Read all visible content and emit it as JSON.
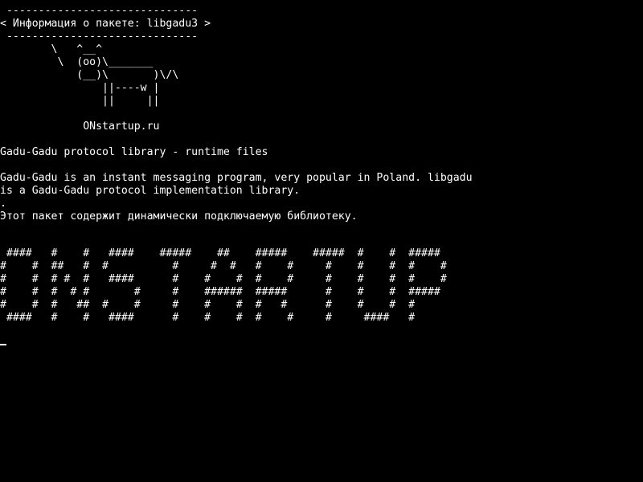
{
  "terminal": {
    "bg_color": "#000000",
    "fg_color": "#ffffff",
    "bubble": {
      "top_border": " ------------------------------",
      "text": "< Информация о пакете: libgadu3 >",
      "bottom_border": " ------------------------------"
    },
    "cow": [
      "        \\   ^__^",
      "         \\  (oo)\\_______",
      "            (__)\\       )\\/\\",
      "                ||----w |",
      "                ||     ||"
    ],
    "site": "             ONstartup.ru",
    "description": {
      "summary": "Gadu-Gadu protocol library - runtime files",
      "body_lines": [
        "Gadu-Gadu is an instant messaging program, very popular in Poland. libgadu",
        "is a Gadu-Gadu protocol implementation library.",
        ".",
        "Этот пакет содержит динамически подключаемую библиотеку."
      ]
    },
    "banner": [
      " ####   #    #   ####    #####    ##    #####    #####  #    #  #####",
      "#    #  ##   #  #          #     #  #   #    #     #    #    #  #    #",
      "#    #  # #  #   ####      #    #    #  #    #     #    #    #  #    #",
      "#    #  #  # #       #     #    ######  #####      #    #    #  #####",
      "#    #  #   ##  #    #     #    #    #  #   #      #    #    #  #",
      " ####   #    #   ####      #    #    #  #    #     #     ####   #"
    ]
  }
}
